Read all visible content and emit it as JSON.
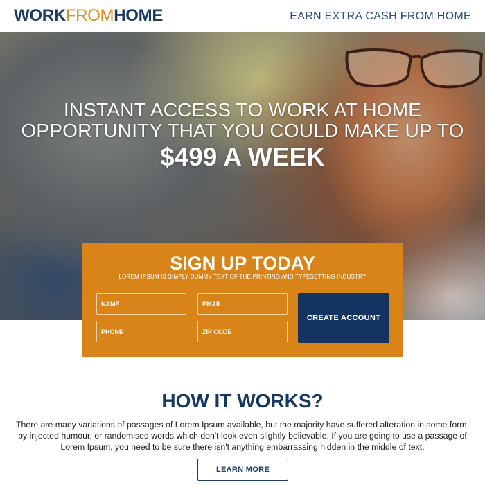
{
  "header": {
    "logo_work": "WORK",
    "logo_from": "FROM",
    "logo_home": "HOME",
    "tagline": "EARN EXTRA CASH FROM HOME"
  },
  "hero": {
    "headline_line1": "INSTANT ACCESS TO WORK AT HOME",
    "headline_line2": "OPPORTUNITY THAT YOU COULD MAKE UP TO",
    "amount": "$499 A WEEK"
  },
  "signup": {
    "title": "SIGN UP TODAY",
    "subtitle": "LOREM IPSUM IS SIMPLY DUMMY TEXT OF THE PRINTING AND TYPESETTING INDUSTRY",
    "name_placeholder": "NAME",
    "email_placeholder": "EMAIL",
    "phone_placeholder": "PHONE",
    "zip_placeholder": "ZIP CODE",
    "button_label": "CREATE ACCOUNT"
  },
  "how_it_works": {
    "title": "HOW IT WORKS?",
    "body": "There are many variations of passages of Lorem Ipsum available, but the majority have suffered alteration in some form, by injected humour, or randomised words which don't look even slightly believable. If you are going to use a passage of Lorem Ipsum, you need to be sure there isn't anything embarrassing hidden in the middle of text.",
    "button_label": "LEARN MORE"
  },
  "colors": {
    "brand_navy": "#1b3a64",
    "brand_orange": "#e08d22",
    "signup_background": "#d98419",
    "button_navy": "#143361"
  }
}
